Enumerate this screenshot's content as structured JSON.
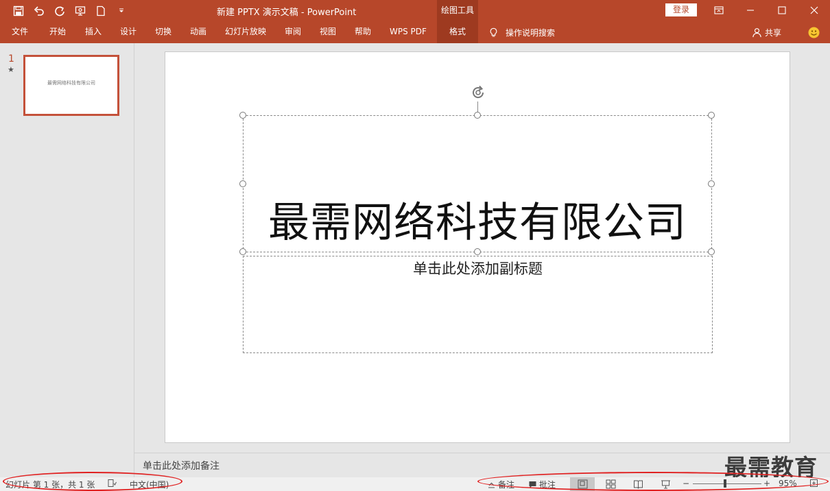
{
  "app": {
    "window_title": "新建 PPTX 演示文稿  -  PowerPoint",
    "context_tool": "绘图工具",
    "login_label": "登录"
  },
  "ribbon": {
    "tabs": [
      {
        "label": "文件"
      },
      {
        "label": "开始"
      },
      {
        "label": "插入"
      },
      {
        "label": "设计"
      },
      {
        "label": "切换"
      },
      {
        "label": "动画"
      },
      {
        "label": "幻灯片放映"
      },
      {
        "label": "审阅"
      },
      {
        "label": "视图"
      },
      {
        "label": "帮助"
      },
      {
        "label": "WPS PDF"
      },
      {
        "label": "格式",
        "active": true
      }
    ],
    "search_label": "操作说明搜索",
    "share_label": "共享"
  },
  "thumbnails": [
    {
      "number": "1",
      "star": "★",
      "text": "最需网络科技有限公司"
    }
  ],
  "slide": {
    "title": "最需网络科技有限公司",
    "subtitle_placeholder": "单击此处添加副标题"
  },
  "notes_placeholder": "单击此处添加备注",
  "watermark": "最需教育",
  "statusbar": {
    "slide_info": "幻灯片 第 1 张，共 1 张",
    "language": "中文(中国)",
    "notes_label": "备注",
    "comments_label": "批注",
    "zoom_minus": "−",
    "zoom_plus": "+",
    "zoom_level": "95%"
  },
  "colors": {
    "accent": "#b7472a",
    "accent_dark": "#9e3a20",
    "annotation": "#e02020"
  }
}
